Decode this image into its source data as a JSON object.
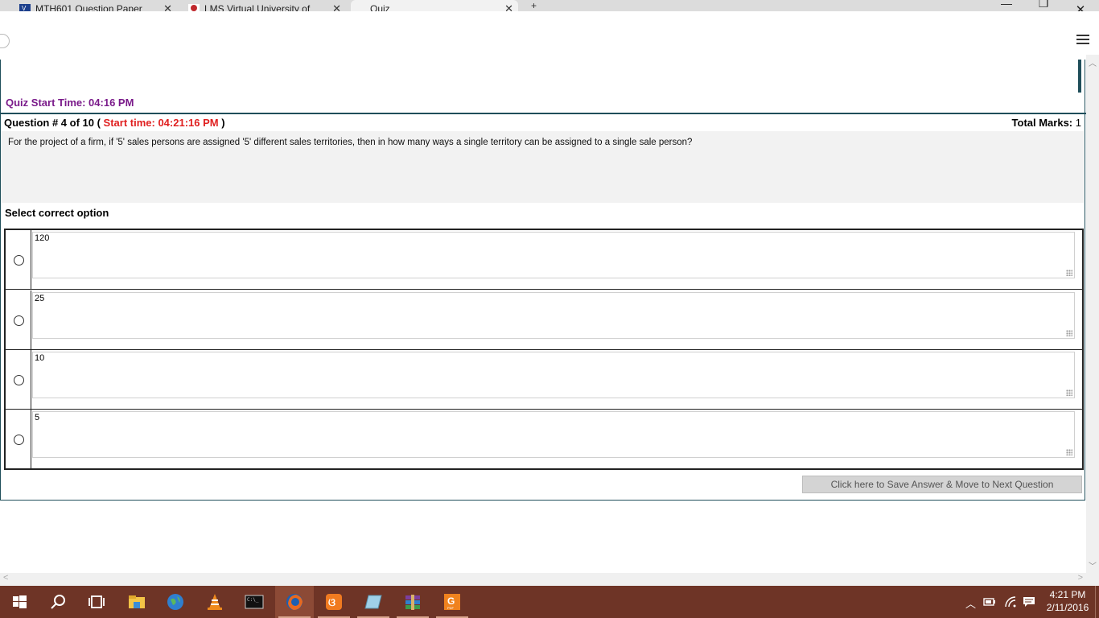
{
  "browser": {
    "tabs": [
      {
        "title": "MTH601 Question Paper",
        "favicon": "vu-icon"
      },
      {
        "title": "LMS Virtual University of",
        "favicon": "lms-icon"
      },
      {
        "title": "Quiz",
        "favicon": "none"
      }
    ],
    "window_controls": {
      "minimize": "—",
      "maximize": "❐",
      "close": "✕"
    }
  },
  "quiz": {
    "start_time_label": "Quiz Start Time: 04:16 PM",
    "question_prefix": "Question # 4 of 10 (",
    "question_start_time": "Start time: 04:21:16 PM",
    "question_suffix": ")",
    "total_marks_label": "Total Marks:",
    "total_marks_value": "1",
    "question_text": "For the project of a firm, if '5' sales persons are assigned '5' different sales territories, then in how many ways a single territory can be assigned to a single sale person?",
    "select_label": "Select correct option",
    "options": [
      "120",
      "25",
      "10",
      "5"
    ],
    "next_button": "Click here to Save Answer & Move to Next Question"
  },
  "taskbar": {
    "apps": [
      "start",
      "search",
      "task-view",
      "file-explorer",
      "network-globe",
      "vlc",
      "command-prompt",
      "firefox",
      "xampp",
      "notepad",
      "winrar",
      "foxit-pdf"
    ],
    "active_app": "firefox",
    "time": "4:21 PM",
    "date": "2/11/2016"
  },
  "colors": {
    "accent_dark": "#1f4e5a",
    "quiz_start": "#7a1a8a",
    "red": "#e02020",
    "taskbar": "#6e3426"
  }
}
